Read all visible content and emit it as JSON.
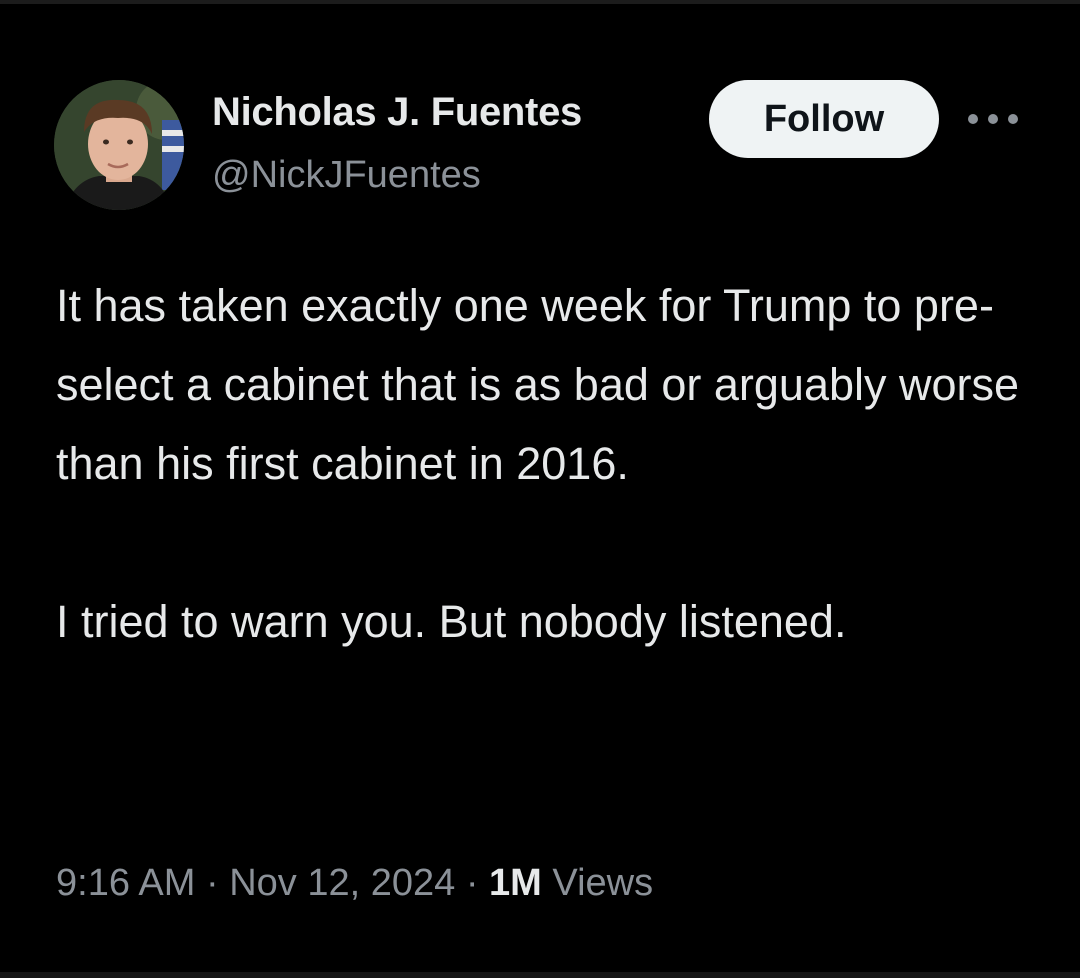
{
  "author": {
    "name": "Nicholas J. Fuentes",
    "handle": "@NickJFuentes"
  },
  "actions": {
    "follow_label": "Follow",
    "more_icon": "more-horizontal-icon"
  },
  "tweet": {
    "paragraph_1": "It has taken exactly one week for Trump to pre-select a cabinet that is as bad or arguably worse than his first cabinet in 2016.",
    "paragraph_2": "I tried to warn you. But nobody listened."
  },
  "meta": {
    "time": "9:16 AM",
    "separator": "·",
    "date": "Nov 12, 2024",
    "views_count": "1M",
    "views_label": "Views"
  },
  "colors": {
    "background": "#000000",
    "text_primary": "#e7e9ea",
    "text_secondary": "#8b9198",
    "follow_bg": "#eff3f4"
  }
}
